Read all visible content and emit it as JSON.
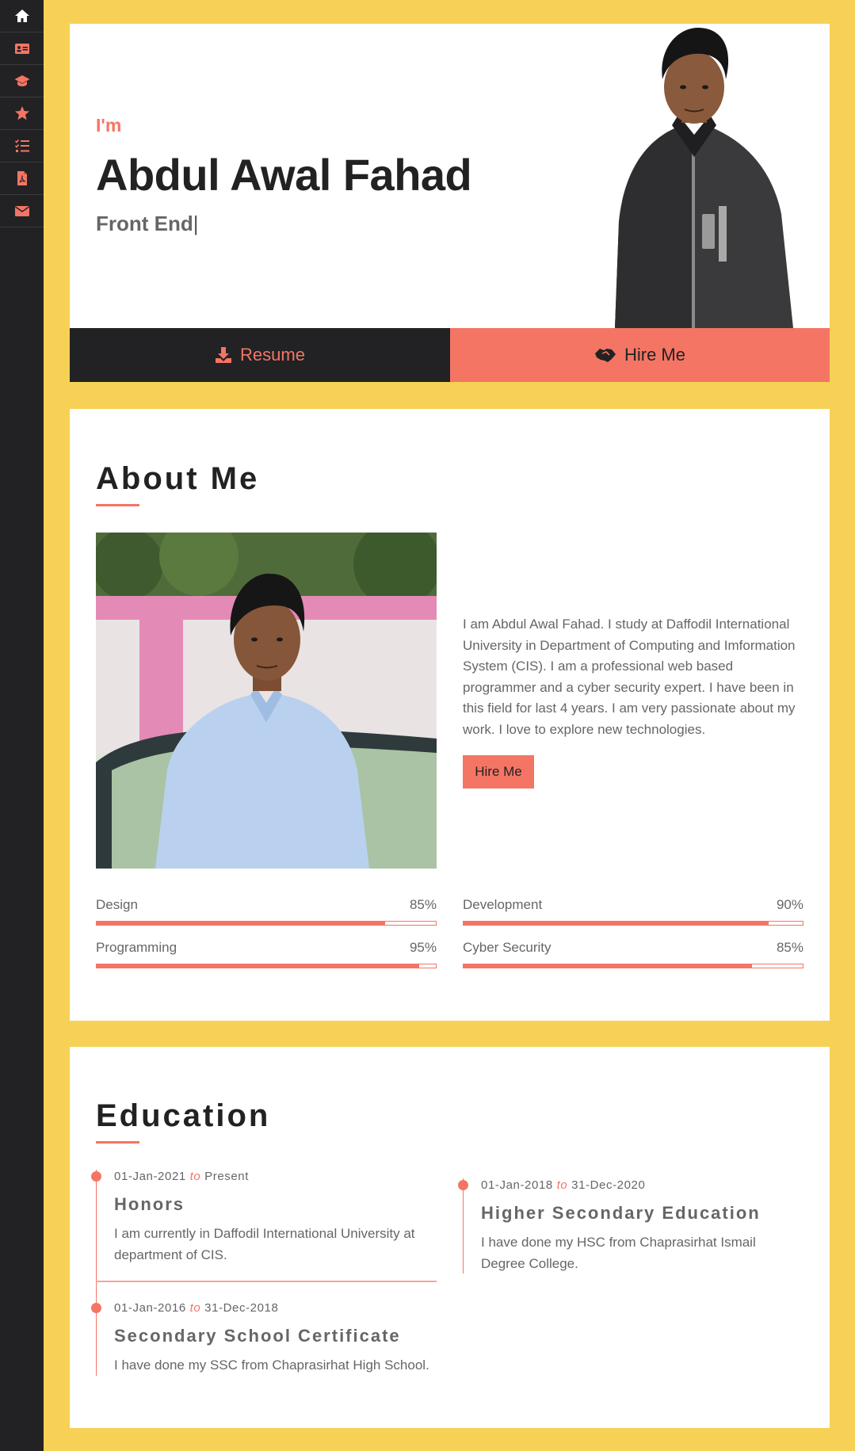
{
  "sidebar": {
    "items": [
      {
        "icon": "home-icon",
        "name": "sidebar-item-home"
      },
      {
        "icon": "id-card-icon",
        "name": "sidebar-item-about"
      },
      {
        "icon": "graduation-cap-icon",
        "name": "sidebar-item-education"
      },
      {
        "icon": "star-icon",
        "name": "sidebar-item-skills"
      },
      {
        "icon": "task-list-icon",
        "name": "sidebar-item-experience"
      },
      {
        "icon": "file-pdf-icon",
        "name": "sidebar-item-resume"
      },
      {
        "icon": "envelope-icon",
        "name": "sidebar-item-contact"
      }
    ]
  },
  "hero": {
    "intro": "I'm",
    "name": "Abdul Awal Fahad",
    "role": "Front End",
    "cursor": "|",
    "resume_label": "Resume",
    "hire_label": "Hire Me"
  },
  "about": {
    "title": "About Me",
    "bio": "I am Abdul Awal Fahad. I study at Daffodil International University in Department of Computing and Imformation System (CIS). I am a professional web based programmer and a cyber security expert. I have been in this field for last 4 years. I am very passionate about my work. I love to explore new technologies.",
    "hire_label": "Hire Me",
    "skills": [
      {
        "label": "Design",
        "percent_text": "85%",
        "value": 0.85
      },
      {
        "label": "Development",
        "percent_text": "90%",
        "value": 0.9
      },
      {
        "label": "Programming",
        "percent_text": "95%",
        "value": 0.95
      },
      {
        "label": "Cyber Security",
        "percent_text": "85%",
        "value": 0.85
      }
    ]
  },
  "education": {
    "title": "Education",
    "connector": "to",
    "items": [
      {
        "start": "01-Jan-2021",
        "end": "Present",
        "title": "Honors",
        "desc": "I am currently in Daffodil International University at department of CIS."
      },
      {
        "start": "01-Jan-2016",
        "end": "31-Dec-2018",
        "title": "Secondary School Certificate",
        "desc": "I have done my SSC from Chaprasirhat High School."
      },
      {
        "start": "01-Jan-2018",
        "end": "31-Dec-2020",
        "title": "Higher Secondary Education",
        "desc": "I have done my HSC from Chaprasirhat Ismail Degree College."
      }
    ]
  },
  "colors": {
    "background": "#f6d155",
    "sidebar": "#222224",
    "accent": "#f47564",
    "text_dark": "#222222",
    "text_body": "#666666"
  }
}
